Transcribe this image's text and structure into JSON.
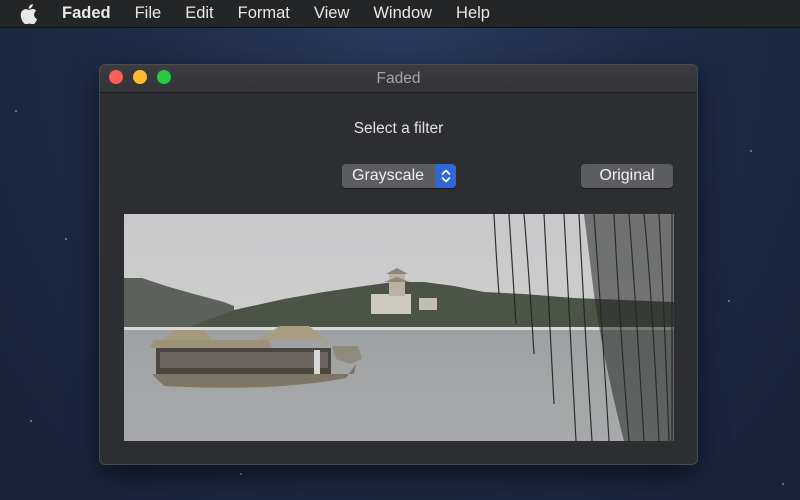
{
  "menubar": {
    "apple_icon": "apple-logo-icon",
    "items": [
      {
        "label": "Faded",
        "is_app": true
      },
      {
        "label": "File"
      },
      {
        "label": "Edit"
      },
      {
        "label": "Format"
      },
      {
        "label": "View"
      },
      {
        "label": "Window"
      },
      {
        "label": "Help"
      }
    ]
  },
  "window": {
    "title": "Faded",
    "controls": [
      "close",
      "minimize",
      "zoom"
    ],
    "prompt_label": "Select a filter",
    "filter_popup": {
      "selected": "Grayscale",
      "accent_color": "#2f66d8"
    },
    "original_button": "Original",
    "image": {
      "description": "Desaturated photo of a dragon boat on a lake with hillside pagoda and willow branches",
      "filter_applied": "Grayscale"
    }
  }
}
